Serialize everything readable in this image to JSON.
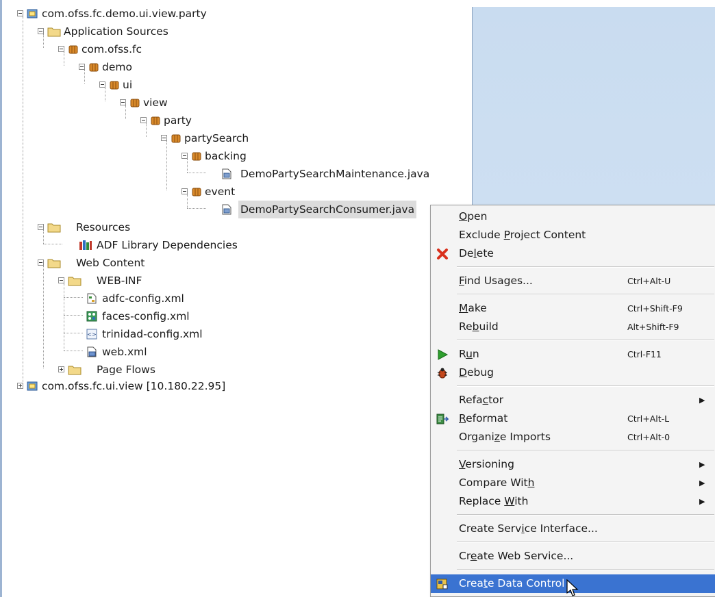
{
  "tree": {
    "project_root": "com.ofss.fc.demo.ui.view.party",
    "application_sources": "Application Sources",
    "packages": [
      "com.ofss.fc",
      "demo",
      "ui",
      "view",
      "party",
      "partySearch",
      "backing"
    ],
    "file_maintenance": "DemoPartySearchMaintenance.java",
    "event_package": "event",
    "file_consumer": "DemoPartySearchConsumer.java",
    "resources": "Resources",
    "adf_library": "ADF Library Dependencies",
    "web_content": "Web Content",
    "web_inf": "WEB-INF",
    "web_inf_files": [
      "adfc-config.xml",
      "faces-config.xml",
      "trinidad-config.xml",
      "web.xml"
    ],
    "page_flows": "Page Flows",
    "other_project": "com.ofss.fc.ui.view [10.180.22.95]"
  },
  "context_menu": {
    "open": {
      "pre": "",
      "u": "O",
      "post": "pen"
    },
    "exclude": {
      "pre": "Exclude ",
      "u": "P",
      "post": "roject Content"
    },
    "delete": {
      "pre": "De",
      "u": "l",
      "post": "ete"
    },
    "find_usages": {
      "pre": "",
      "u": "F",
      "post": "ind Usages...",
      "shortcut": "Ctrl+Alt-U"
    },
    "make": {
      "pre": "",
      "u": "M",
      "post": "ake",
      "shortcut": "Ctrl+Shift-F9"
    },
    "rebuild": {
      "pre": "Re",
      "u": "b",
      "post": "uild",
      "shortcut": "Alt+Shift-F9"
    },
    "run": {
      "pre": "R",
      "u": "u",
      "post": "n",
      "shortcut": "Ctrl-F11"
    },
    "debug": {
      "pre": "",
      "u": "D",
      "post": "ebug"
    },
    "refactor": {
      "pre": "Refa",
      "u": "c",
      "post": "tor"
    },
    "reformat": {
      "pre": "",
      "u": "R",
      "post": "eformat",
      "shortcut": "Ctrl+Alt-L"
    },
    "organize": {
      "pre": "Organi",
      "u": "z",
      "post": "e Imports",
      "shortcut": "Ctrl+Alt-0"
    },
    "versioning": {
      "pre": "",
      "u": "V",
      "post": "ersioning"
    },
    "compare": {
      "pre": "Compare Wit",
      "u": "h",
      "post": ""
    },
    "replace": {
      "pre": "Replace ",
      "u": "W",
      "post": "ith"
    },
    "service_interface": {
      "pre": "Create Serv",
      "u": "i",
      "post": "ce Interface..."
    },
    "web_service": {
      "pre": "Cr",
      "u": "e",
      "post": "ate Web Service..."
    },
    "data_control": {
      "pre": "Crea",
      "u": "t",
      "post": "e Data Control"
    },
    "submenu_arrow": "▶",
    "colors": {
      "highlight": "#3a73d1",
      "background": "#f4f4f4"
    }
  }
}
